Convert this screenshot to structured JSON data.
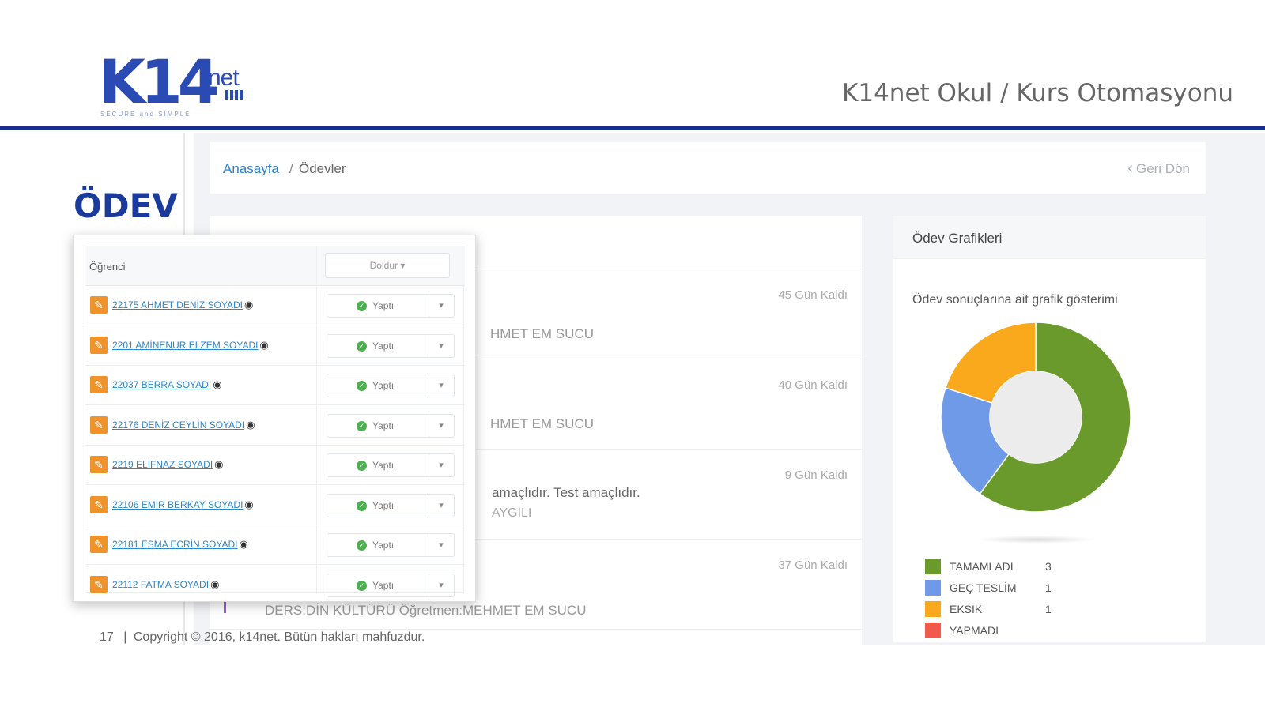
{
  "logo": {
    "main": "K14",
    "net": "net",
    "tagline": "SECURE and SIMPLE"
  },
  "slide_title": "K14net Okul / Kurs Otomasyonu",
  "section_heading": "ÖDEV",
  "breadcrumb": {
    "home": "Anasayfa",
    "separator": "/",
    "current": "Ödevler"
  },
  "back_button": {
    "icon": "chevron-left-icon",
    "label": "Geri Dön"
  },
  "homework_rows": [
    {
      "days_left": "45 Gün Kaldı",
      "teacher": "HMET EM SUCU"
    },
    {
      "days_left": "40 Gün Kaldı",
      "teacher": "HMET EM SUCU"
    },
    {
      "days_left": "9 Gün Kaldı",
      "description": "amaçlıdır. Test amaçlıdır.",
      "subtext": "AYGILI"
    },
    {
      "days_left": "37 Gün Kaldı",
      "full_line": "DERS:DİN KÜLTÜRÜ Öğretmen:MEHMET EM SUCU"
    }
  ],
  "chart_panel": {
    "title": "Ödev Grafikleri",
    "subtitle": "Ödev sonuçlarına ait grafik gösterimi"
  },
  "chart_data": {
    "type": "pie",
    "variant": "donut",
    "categories": [
      "TAMAMLADI",
      "GEÇ TESLİM",
      "EKSİK",
      "YAPMADI"
    ],
    "values": [
      3,
      1,
      1,
      0
    ],
    "colors": [
      "#6b9a2c",
      "#6f9ae8",
      "#f9a91b",
      "#ef5a4a"
    ],
    "legend_position": "bottom"
  },
  "popup": {
    "column_header": "Öğrenci",
    "fill_button": "Doldur ▾",
    "status_label": "Yaptı",
    "dropdown": "▾",
    "students": [
      "22175 AHMET DENİZ SOYADI",
      "2201 AMİNENUR ELZEM SOYADI",
      "22037 BERRA SOYADI",
      "22176 DENİZ CEYLİN SOYADI",
      "2219 ELİFNAZ SOYADI",
      "22106 EMİR BERKAY SOYADI",
      "22181 ESMA ECRİN SOYADI",
      "22112 FATMA SOYADI"
    ]
  },
  "footer": {
    "page": "17",
    "separator": "|",
    "copyright": "Copyright © 2016, k14net. Bütün hakları mahfuzdur."
  },
  "colors": {
    "brand": "#2a4bb3",
    "header_rule": "#1a2c8c",
    "link": "#2f86c8",
    "edit": "#f0932b"
  }
}
